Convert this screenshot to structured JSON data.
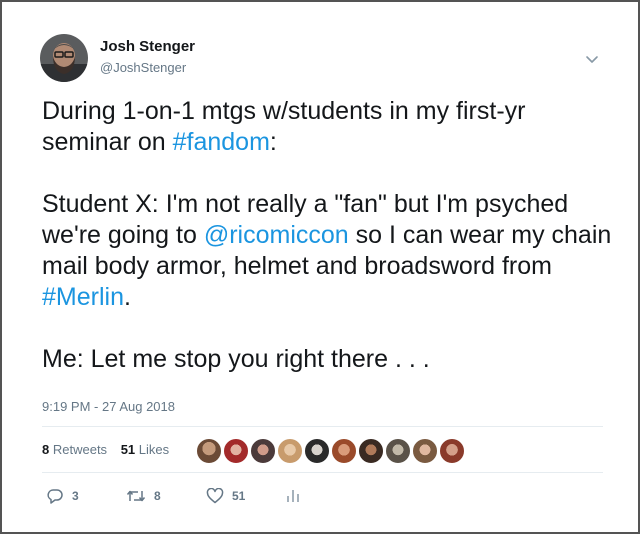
{
  "user": {
    "display_name": "Josh Stenger",
    "handle": "@JoshStenger"
  },
  "tweet": {
    "lines": [
      {
        "text_1": "During 1-on-1 mtgs w/students in my first-yr seminar on ",
        "link": "#fandom",
        "text_2": ":"
      },
      {
        "text_1": "Student X: I'm not really a \"fan\" but I'm psyched we're going to ",
        "link": "@ricomiccon",
        "text_2": " so I can wear my chain mail body armor, helmet and broadsword from "
      },
      {
        "link": "#Merlin",
        "text": "."
      },
      {
        "text": "Me: Let me stop you right there . . ."
      }
    ],
    "timestamp": "9:19 PM - 27 Aug 2018"
  },
  "stats": {
    "retweets_count": "8",
    "retweets_label": "Retweets",
    "likes_count": "51",
    "likes_label": "Likes"
  },
  "liker_avatars": [
    "avatar",
    "avatar",
    "avatar",
    "avatar",
    "avatar",
    "avatar",
    "avatar",
    "avatar",
    "avatar",
    "avatar"
  ],
  "actions": {
    "reply_count": "3",
    "retweet_count": "8",
    "like_count": "51"
  },
  "icons": {
    "menu": "chevron-down-icon",
    "reply": "reply-icon",
    "retweet": "retweet-icon",
    "like": "heart-icon",
    "analytics": "analytics-icon"
  },
  "colors": {
    "link": "#1b95e0",
    "secondary_text": "#657786",
    "primary_text": "#14171a"
  }
}
